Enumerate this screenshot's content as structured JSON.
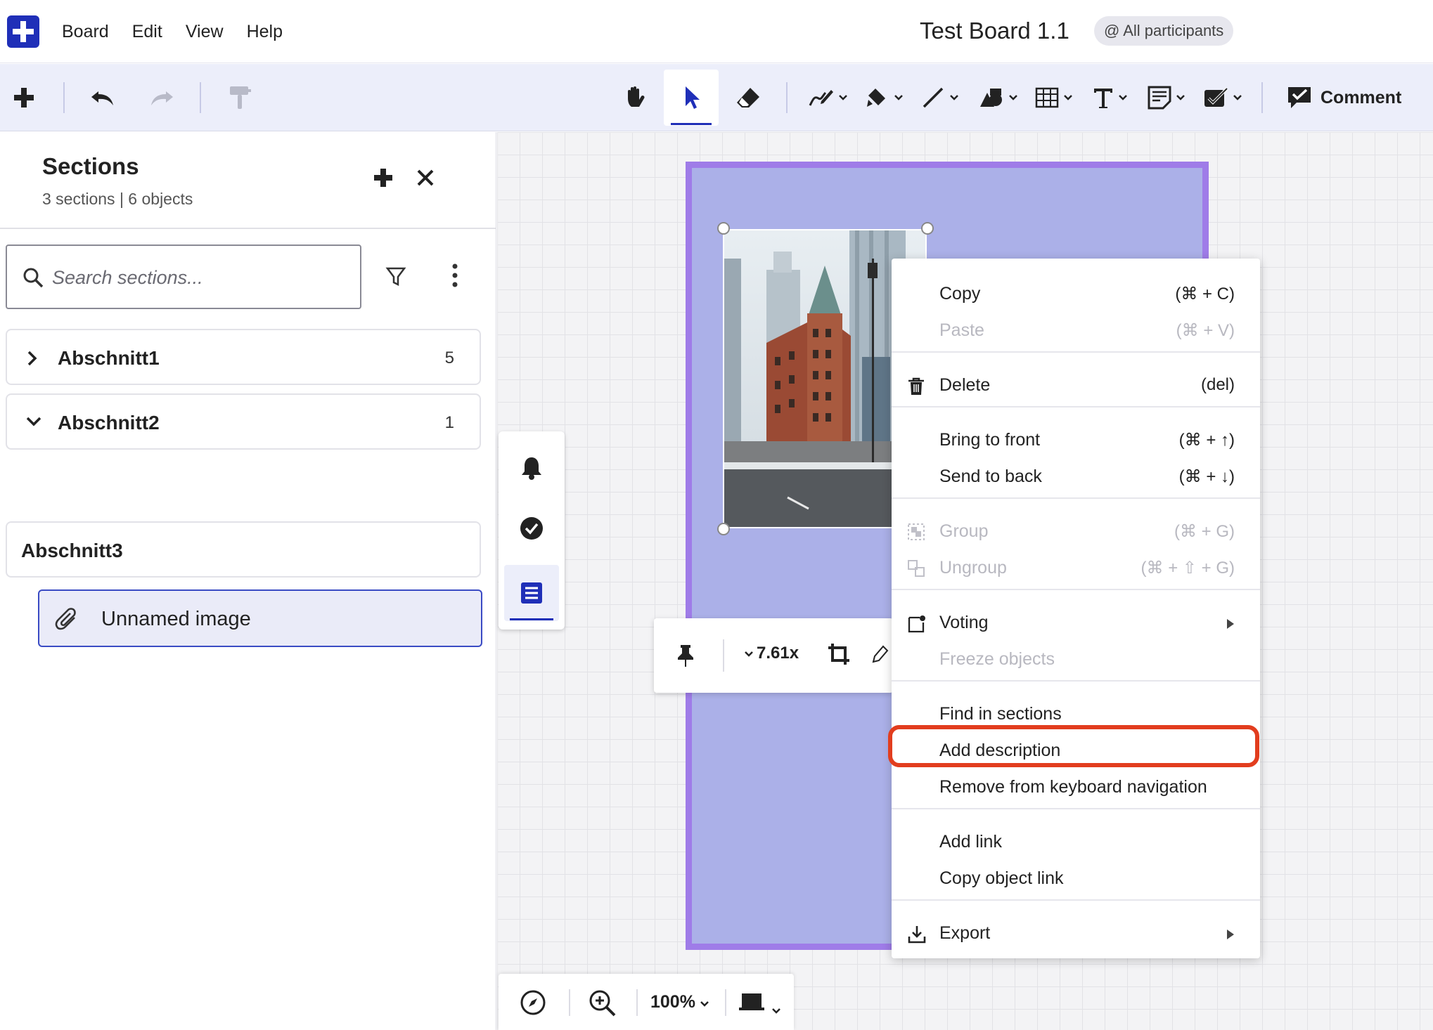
{
  "menubar": {
    "menus": [
      "Board",
      "Edit",
      "View",
      "Help"
    ],
    "board_title": "Test Board 1.1",
    "participants": "@ All participants"
  },
  "toolbar": {
    "comment_label": "Comment",
    "active_tool": "select"
  },
  "sections_panel": {
    "title": "Sections",
    "subtitle": "3 sections | 6 objects",
    "search_placeholder": "Search sections...",
    "sections": [
      {
        "label": "Abschnitt1",
        "count": "5",
        "expanded": false
      },
      {
        "label": "Abschnitt2",
        "count": "1",
        "expanded": true
      },
      {
        "label": "Abschnitt3",
        "count": "",
        "expanded": false
      }
    ],
    "selected_item": "Unnamed image"
  },
  "image_toolbar": {
    "zoom_label": "7.61x"
  },
  "zoombar": {
    "zoom": "100%"
  },
  "context_menu": {
    "items": [
      {
        "label": "Copy",
        "shortcut": "(⌘ + C)",
        "disabled": false
      },
      {
        "label": "Paste",
        "shortcut": "(⌘ + V)",
        "disabled": true
      },
      {
        "label": "Delete",
        "shortcut": "(del)",
        "disabled": false,
        "icon": "trash-icon"
      },
      {
        "label": "Bring to front",
        "shortcut": "(⌘ + ↑)",
        "disabled": false
      },
      {
        "label": "Send to back",
        "shortcut": "(⌘ + ↓)",
        "disabled": false
      },
      {
        "label": "Group",
        "shortcut": "(⌘ + G)",
        "disabled": true,
        "icon": "group-icon"
      },
      {
        "label": "Ungroup",
        "shortcut": "(⌘ + ⇧ + G)",
        "disabled": true,
        "icon": "ungroup-icon"
      },
      {
        "label": "Voting",
        "shortcut": "",
        "disabled": false,
        "icon": "voting-icon",
        "submenu": true
      },
      {
        "label": "Freeze objects",
        "shortcut": "",
        "disabled": true
      },
      {
        "label": "Find in sections",
        "shortcut": "",
        "disabled": false
      },
      {
        "label": "Add description",
        "shortcut": "",
        "disabled": false,
        "highlighted": true
      },
      {
        "label": "Remove from keyboard navigation",
        "shortcut": "",
        "disabled": false
      },
      {
        "label": "Add link",
        "shortcut": "",
        "disabled": false
      },
      {
        "label": "Copy object link",
        "shortcut": "",
        "disabled": false
      },
      {
        "label": "Export",
        "shortcut": "",
        "disabled": false,
        "icon": "export-icon",
        "submenu": true
      }
    ]
  },
  "colors": {
    "brand": "#1f2fb8",
    "frame_fill": "#abb0e8",
    "frame_border": "#9f7ce8",
    "highlight": "#e23d1e"
  }
}
